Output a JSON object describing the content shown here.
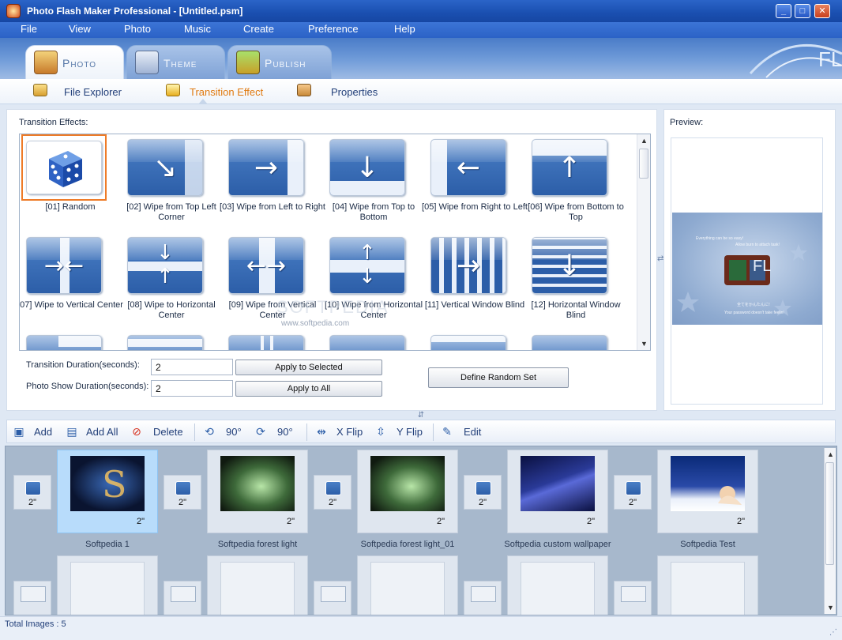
{
  "window": {
    "title": "Photo Flash Maker Professional - [Untitled.psm]"
  },
  "menu": [
    "File",
    "View",
    "Photo",
    "Music",
    "Create",
    "Preference",
    "Help"
  ],
  "tabs": [
    {
      "label": "Photo",
      "active": true
    },
    {
      "label": "Theme",
      "active": false
    },
    {
      "label": "Publish",
      "active": false
    }
  ],
  "subtabs": [
    {
      "label": "File Explorer"
    },
    {
      "label": "Transition Effect",
      "active": true
    },
    {
      "label": "Properties"
    }
  ],
  "effects": {
    "heading": "Transition Effects:",
    "items": [
      {
        "label": "[01] Random",
        "icon": "dice-icon"
      },
      {
        "label": "[02] Wipe from Top Left Corner",
        "icon": "arrow-down-right-icon"
      },
      {
        "label": "[03] Wipe from Left to Right",
        "icon": "arrow-right-icon"
      },
      {
        "label": "[04] Wipe from Top to Bottom",
        "icon": "arrow-down-icon"
      },
      {
        "label": "[05] Wipe from Right to Left",
        "icon": "arrow-left-icon"
      },
      {
        "label": "[06] Wipe from Bottom to Top",
        "icon": "arrow-up-icon"
      },
      {
        "label": "[07] Wipe to Vertical Center",
        "icon": "arrows-in-horizontal-icon"
      },
      {
        "label": "[08] Wipe to Horizontal Center",
        "icon": "arrows-in-vertical-icon"
      },
      {
        "label": "[09] Wipe from Vertical Center",
        "icon": "arrows-out-horizontal-icon"
      },
      {
        "label": "[10] Wipe from Horizontal Center",
        "icon": "arrows-out-vertical-icon"
      },
      {
        "label": "[11] Vertical Window Blind",
        "icon": "vertical-blind-icon"
      },
      {
        "label": "[12] Horizontal Window Blind",
        "icon": "horizontal-blind-icon"
      }
    ]
  },
  "settings": {
    "transition_duration_label": "Transition Duration(seconds):",
    "transition_duration": "2",
    "show_duration_label": "Photo Show Duration(seconds):",
    "show_duration": "2",
    "apply_selected": "Apply to Selected",
    "apply_all": "Apply to All",
    "define_random": "Define Random Set"
  },
  "preview": {
    "heading": "Preview:",
    "line1": "Everything can be so easy!",
    "line2": "Allow burn to attach task!",
    "line3": "全てをかんたんに!",
    "line4": "Your password doesn't take feelin!",
    "logo_text": "FL"
  },
  "watermark": {
    "text": "SOFTPEDIA",
    "url": "www.softpedia.com"
  },
  "toolbar": {
    "add": "Add",
    "add_all": "Add All",
    "delete": "Delete",
    "rotate_left": "90°",
    "rotate_right": "90°",
    "x_flip": "X Flip",
    "y_flip": "Y Flip",
    "edit": "Edit"
  },
  "photos": [
    {
      "name": "Softpedia 1",
      "duration": "2\"",
      "selected": true
    },
    {
      "name": "Softpedia forest light",
      "duration": "2\""
    },
    {
      "name": "Softpedia forest light_01",
      "duration": "2\""
    },
    {
      "name": "Softpedia custom wallpaper",
      "duration": "2\""
    },
    {
      "name": "Softpedia Test",
      "duration": "2\""
    }
  ],
  "transition_duration_badge": "2\"",
  "status": {
    "total_images": "Total Images : 5"
  },
  "colors": {
    "titlebar": "#1a4fb0",
    "accent": "#e07a10",
    "selection": "#b8dcfb"
  }
}
